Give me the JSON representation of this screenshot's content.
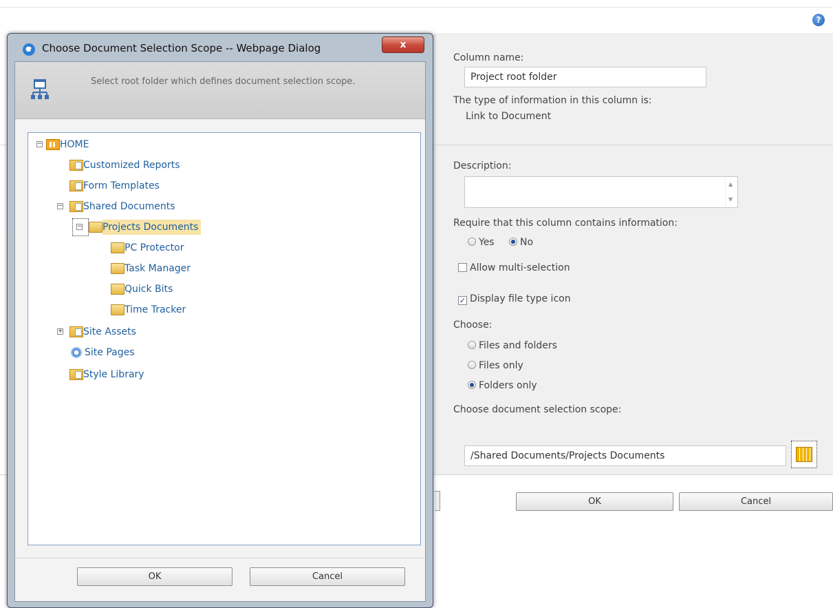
{
  "help_icon": "?",
  "page": {
    "column_name_label": "Column name:",
    "column_name_value": "Project root folder",
    "type_label": "The type of information in this column is:",
    "type_value": "Link to Document",
    "description_label": "Description:",
    "require_label": "Require that this column contains information:",
    "require_yes": "Yes",
    "require_no": "No",
    "allow_multi_label": "Allow multi-selection",
    "display_icon_label": "Display file type icon",
    "choose_label": "Choose:",
    "choose_files_folders": "Files and folders",
    "choose_files_only": "Files only",
    "choose_folders_only": "Folders only",
    "scope_label": "Choose document selection scope:",
    "scope_value": "/Shared Documents/Projects Documents",
    "ok_label": "OK",
    "cancel_label": "Cancel"
  },
  "dialog": {
    "title": "Choose Document Selection Scope -- Webpage Dialog",
    "close": "x",
    "header_text": "Select root folder which defines document selection scope.",
    "tree": {
      "home": "HOME",
      "customized_reports": "Customized Reports",
      "form_templates": "Form Templates",
      "shared_documents": "Shared Documents",
      "projects_documents": "Projects Documents",
      "pc_protector": "PC Protector",
      "task_manager": "Task Manager",
      "quick_bits": "Quick Bits",
      "time_tracker": "Time Tracker",
      "site_assets": "Site Assets",
      "site_pages": "Site Pages",
      "style_library": "Style Library"
    },
    "ok_label": "OK",
    "cancel_label": "Cancel"
  }
}
